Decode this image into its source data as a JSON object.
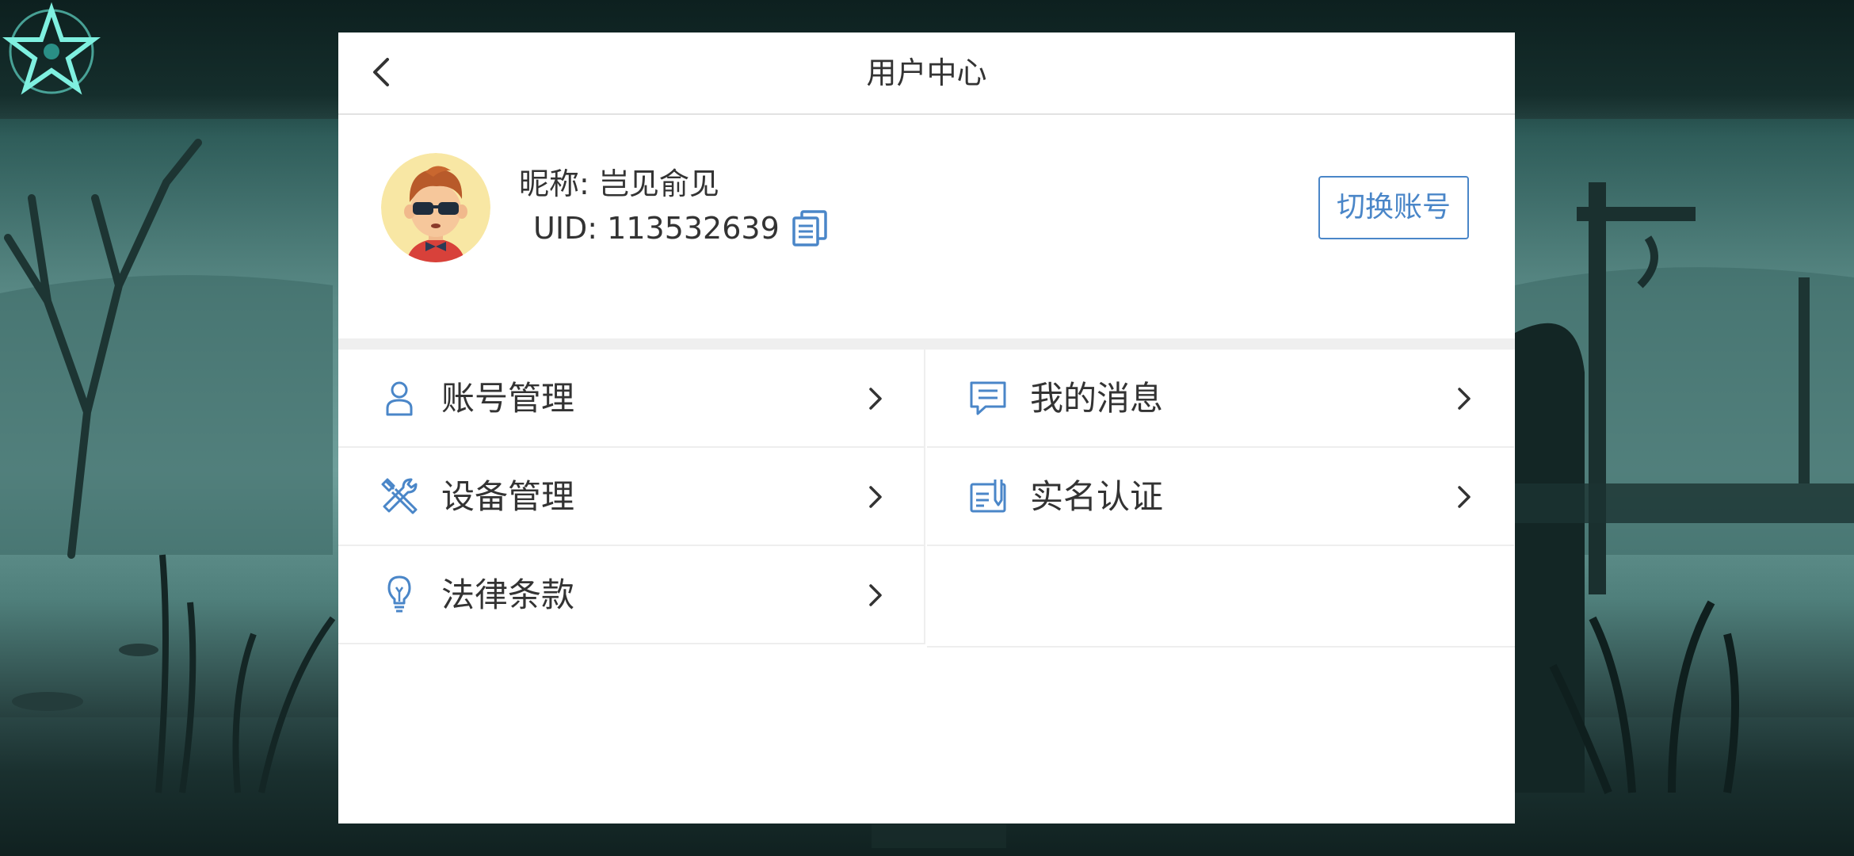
{
  "header": {
    "title": "用户中心"
  },
  "profile": {
    "nickname": "昵称: 岂见俞见",
    "uid": "UID: 113532639",
    "switch_account_label": "切换账号"
  },
  "menu": {
    "items": [
      {
        "label": "账号管理",
        "icon": "user-icon"
      },
      {
        "label": "我的消息",
        "icon": "message-icon"
      },
      {
        "label": "设备管理",
        "icon": "tools-icon"
      },
      {
        "label": "实名认证",
        "icon": "id-card-icon"
      },
      {
        "label": "法律条款",
        "icon": "lightbulb-icon"
      }
    ]
  },
  "colors": {
    "accent": "#4a86c8",
    "text": "#333333",
    "divider": "#eeeeee"
  }
}
